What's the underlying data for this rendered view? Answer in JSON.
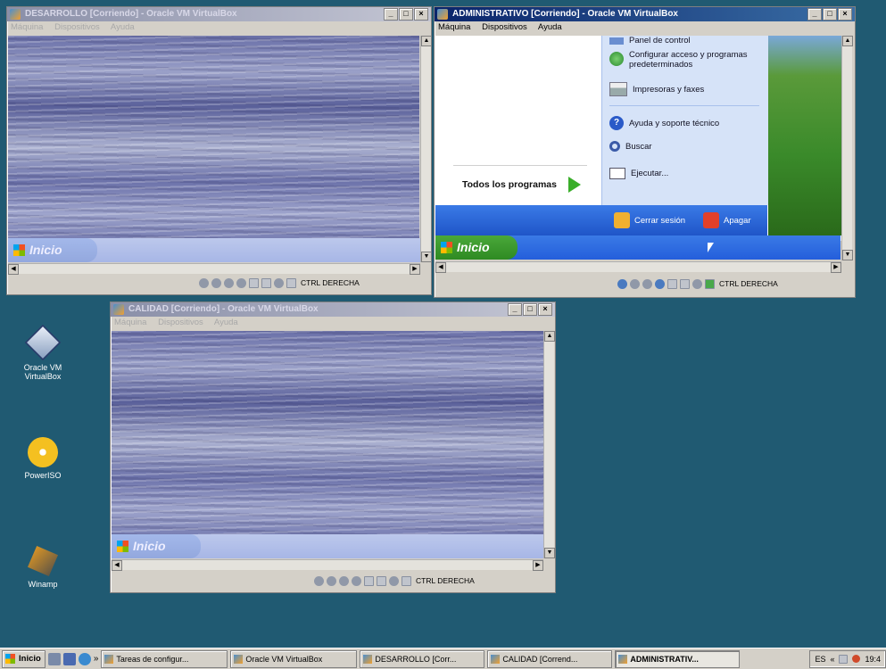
{
  "windows": {
    "desarrollo": {
      "title": "DESARROLLO [Corriendo] - Oracle VM VirtualBox",
      "menu": [
        "Máquina",
        "Dispositivos",
        "Ayuda"
      ],
      "start_label": "Inicio",
      "host_key": "CTRL DERECHA"
    },
    "administrativo": {
      "title": "ADMINISTRATIVO [Corriendo] - Oracle VM VirtualBox",
      "menu": [
        "Máquina",
        "Dispositivos",
        "Ayuda"
      ],
      "start_label": "Inicio",
      "host_key": "CTRL DERECHA",
      "start_menu": {
        "items": [
          {
            "label": "Panel de control",
            "icon": "control-panel-icon"
          },
          {
            "label": "Configurar acceso y programas predeterminados",
            "icon": "default-programs-icon"
          },
          {
            "label": "Impresoras y faxes",
            "icon": "printer-icon"
          },
          {
            "label": "Ayuda y soporte técnico",
            "icon": "help-icon"
          },
          {
            "label": "Buscar",
            "icon": "search-icon"
          },
          {
            "label": "Ejecutar...",
            "icon": "run-icon"
          }
        ],
        "all_programs": "Todos los programas",
        "logoff": "Cerrar sesión",
        "shutdown": "Apagar"
      }
    },
    "calidad": {
      "title": "CALIDAD [Corriendo] - Oracle VM VirtualBox",
      "menu": [
        "Máquina",
        "Dispositivos",
        "Ayuda"
      ],
      "start_label": "Inicio",
      "host_key": "CTRL DERECHA"
    }
  },
  "desktop_icons": [
    {
      "label": "Oracle VM VirtualBox",
      "icon": "virtualbox-icon"
    },
    {
      "label": "PowerISO",
      "icon": "poweriso-icon"
    },
    {
      "label": "Winamp",
      "icon": "winamp-icon"
    }
  ],
  "taskbar": {
    "start_label": "Inicio",
    "buttons": [
      {
        "label": "Tareas de configur...",
        "active": false
      },
      {
        "label": "Oracle VM VirtualBox",
        "active": false
      },
      {
        "label": "DESARROLLO [Corr...",
        "active": false
      },
      {
        "label": "CALIDAD [Corrend...",
        "active": false
      },
      {
        "label": "ADMINISTRATIV...",
        "active": true
      }
    ],
    "tray": {
      "language": "ES",
      "time": "19:4"
    }
  },
  "colors": {
    "desktop": "#205a72",
    "xp_blue": "#245edb",
    "xp_green": "#3a9a2a"
  }
}
